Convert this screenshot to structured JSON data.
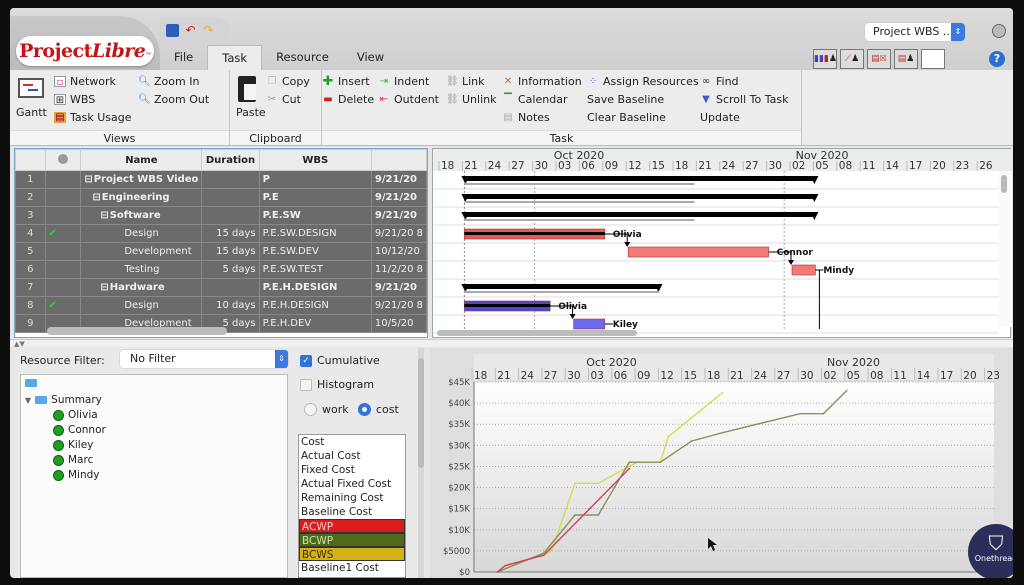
{
  "app": {
    "logo_main": "Project",
    "logo_italic": "Libre",
    "logo_tm": "™",
    "project_selector": "Project WBS ...",
    "quick_icons": [
      "save-icon",
      "undo-icon",
      "redo-icon"
    ],
    "menu_tabs": [
      "File",
      "Task",
      "Resource",
      "View"
    ],
    "active_tab": "Task",
    "view_buttons": [
      "resource-histogram-icon",
      "resource-chart-icon",
      "task-usage-close-icon",
      "resource-usage-icon",
      "blank"
    ],
    "help_label": "?"
  },
  "ribbon": {
    "views": {
      "title": "Views",
      "gantt": "Gantt",
      "network": "Network",
      "wbs": "WBS",
      "task_usage": "Task Usage",
      "zoom_in": "Zoom In",
      "zoom_out": "Zoom Out"
    },
    "clipboard": {
      "title": "Clipboard",
      "paste": "Paste",
      "copy": "Copy",
      "cut": "Cut"
    },
    "task": {
      "title": "Task",
      "insert": "Insert",
      "delete": "Delete",
      "indent": "Indent",
      "outdent": "Outdent",
      "link": "Link",
      "unlink": "Unlink",
      "information": "Information",
      "calendar": "Calendar",
      "notes": "Notes",
      "assign_resources": "Assign Resources",
      "save_baseline": "Save Baseline",
      "clear_baseline": "Clear Baseline",
      "find": "Find",
      "scroll_to_task": "Scroll To Task",
      "update": "Update"
    }
  },
  "task_table": {
    "columns": [
      "",
      "@",
      "Name",
      "Duration",
      "WBS",
      ""
    ],
    "rows": [
      {
        "id": "1",
        "check": false,
        "name": "Project WBS Video",
        "level": 0,
        "summary": true,
        "duration": "",
        "wbs": "P",
        "start": "9/21/20"
      },
      {
        "id": "2",
        "check": false,
        "name": "Engineering",
        "level": 1,
        "summary": true,
        "duration": "",
        "wbs": "P.E",
        "start": "9/21/20"
      },
      {
        "id": "3",
        "check": false,
        "name": "Software",
        "level": 2,
        "summary": true,
        "duration": "",
        "wbs": "P.E.SW",
        "start": "9/21/20"
      },
      {
        "id": "4",
        "check": true,
        "name": "Design",
        "level": 3,
        "summary": false,
        "duration": "15 days",
        "wbs": "P.E.SW.DESIGN",
        "start": "9/21/20 8"
      },
      {
        "id": "5",
        "check": false,
        "name": "Development",
        "level": 3,
        "summary": false,
        "duration": "15 days",
        "wbs": "P.E.SW.DEV",
        "start": "10/12/20"
      },
      {
        "id": "6",
        "check": false,
        "name": "Testing",
        "level": 3,
        "summary": false,
        "duration": "5 days",
        "wbs": "P.E.SW.TEST",
        "start": "11/2/20 8"
      },
      {
        "id": "7",
        "check": false,
        "name": "Hardware",
        "level": 2,
        "summary": true,
        "duration": "",
        "wbs": "P.E.H.DESIGN",
        "start": "9/21/20"
      },
      {
        "id": "8",
        "check": true,
        "name": "Design",
        "level": 3,
        "summary": false,
        "duration": "10 days",
        "wbs": "P.E.H.DESIGN",
        "start": "9/21/20 8"
      },
      {
        "id": "9",
        "check": false,
        "name": "Development",
        "level": 3,
        "summary": false,
        "duration": "5 days",
        "wbs": "P.E.H.DEV",
        "start": "10/5/20"
      }
    ]
  },
  "gantt": {
    "months": [
      {
        "label": "Oct 2020"
      },
      {
        "label": "Nov 2020"
      }
    ],
    "day_ticks": [
      "18",
      "21",
      "24",
      "27",
      "30",
      "03",
      "06",
      "09",
      "12",
      "15",
      "18",
      "21",
      "24",
      "27",
      "30",
      "02",
      "05",
      "08",
      "11",
      "14",
      "17",
      "20",
      "23",
      "26"
    ],
    "bars": [
      {
        "row": 1,
        "type": "summary",
        "start_day": 3,
        "end_day": 48
      },
      {
        "row": 2,
        "type": "summary",
        "start_day": 3,
        "end_day": 48
      },
      {
        "row": 3,
        "type": "summary",
        "start_day": 3,
        "end_day": 48
      },
      {
        "row": 4,
        "type": "task",
        "color": "#e85a5a",
        "start_day": 3,
        "end_day": 21,
        "progress": 1.0,
        "resource": "Olivia"
      },
      {
        "row": 5,
        "type": "task",
        "color": "#f47a7a",
        "start_day": 24,
        "end_day": 42,
        "progress": 0,
        "resource": "Connor"
      },
      {
        "row": 6,
        "type": "task",
        "color": "#f47a7a",
        "start_day": 45,
        "end_day": 48,
        "progress": 0,
        "resource": "Mindy"
      },
      {
        "row": 7,
        "type": "summary",
        "start_day": 3,
        "end_day": 28
      },
      {
        "row": 8,
        "type": "task",
        "color": "#4a4ad8",
        "start_day": 3,
        "end_day": 14,
        "progress": 1.0,
        "resource": "Olivia"
      },
      {
        "row": 9,
        "type": "task",
        "color": "#6a6af0",
        "start_day": 17,
        "end_day": 21,
        "progress": 0,
        "resource": "Kiley"
      }
    ]
  },
  "resources": {
    "filter_label": "Resource Filter:",
    "filter_value": "No Filter",
    "tree_root": "Summary",
    "items": [
      "Olivia",
      "Connor",
      "Kiley",
      "Marc",
      "Mindy"
    ]
  },
  "chart_options": {
    "cumulative_label": "Cumulative",
    "cumulative_checked": true,
    "histogram_label": "Histogram",
    "histogram_checked": false,
    "work_label": "work",
    "cost_label": "cost",
    "selected_mode": "cost",
    "metrics": [
      {
        "label": "Cost",
        "bg": "",
        "fg": ""
      },
      {
        "label": "Actual Cost",
        "bg": "",
        "fg": ""
      },
      {
        "label": "Fixed Cost",
        "bg": "",
        "fg": ""
      },
      {
        "label": "Actual Fixed Cost",
        "bg": "",
        "fg": ""
      },
      {
        "label": "Remaining Cost",
        "bg": "",
        "fg": ""
      },
      {
        "label": "Baseline Cost",
        "bg": "",
        "fg": ""
      },
      {
        "label": "ACWP",
        "bg": "#d91c1c",
        "fg": "#ffd0d0"
      },
      {
        "label": "BCWP",
        "bg": "#4d6b1a",
        "fg": "#d0e0b0"
      },
      {
        "label": "BCWS",
        "bg": "#d4b215",
        "fg": "#3a2e00"
      },
      {
        "label": "Baseline1 Cost",
        "bg": "",
        "fg": ""
      }
    ]
  },
  "chart_data": {
    "type": "line",
    "title": "",
    "xlabel": "",
    "ylabel": "",
    "x_unit": "days since Sep 18 2020",
    "months": [
      "Oct 2020",
      "Nov 2020"
    ],
    "x_tick_labels": [
      "18",
      "21",
      "24",
      "27",
      "30",
      "03",
      "06",
      "09",
      "12",
      "15",
      "18",
      "21",
      "24",
      "27",
      "30",
      "02",
      "05",
      "08",
      "11",
      "14",
      "17",
      "20",
      "23"
    ],
    "y_tick_labels": [
      "$0",
      "$5000",
      "$10K",
      "$15K",
      "$20K",
      "$25K",
      "$30K",
      "$35K",
      "$40K",
      "$45K"
    ],
    "y_ticks": [
      0,
      5000,
      10000,
      15000,
      20000,
      25000,
      30000,
      35000,
      40000,
      45000
    ],
    "ylim": [
      0,
      45000
    ],
    "xlim": [
      0,
      69
    ],
    "grid": true,
    "series": [
      {
        "name": "BCWS",
        "color": "#d6dc4a",
        "x": [
          3,
          6,
          9,
          10,
          13,
          16,
          21,
          24,
          25,
          27,
          32
        ],
        "y": [
          0,
          2500,
          4000,
          5000,
          21000,
          21000,
          26000,
          26000,
          32000,
          35000,
          42500
        ]
      },
      {
        "name": "BCWP",
        "color": "#8a9060",
        "x": [
          3,
          9,
          13,
          16,
          20,
          24,
          28,
          32,
          42,
          45,
          48
        ],
        "y": [
          0,
          4500,
          13500,
          13500,
          26000,
          26000,
          31000,
          33000,
          37500,
          37500,
          43000
        ]
      },
      {
        "name": "ACWP",
        "color": "#d0405a",
        "x": [
          3,
          4,
          9,
          20
        ],
        "y": [
          0,
          1500,
          4000,
          24500
        ]
      }
    ]
  },
  "watermark": {
    "label": "Onethread"
  }
}
